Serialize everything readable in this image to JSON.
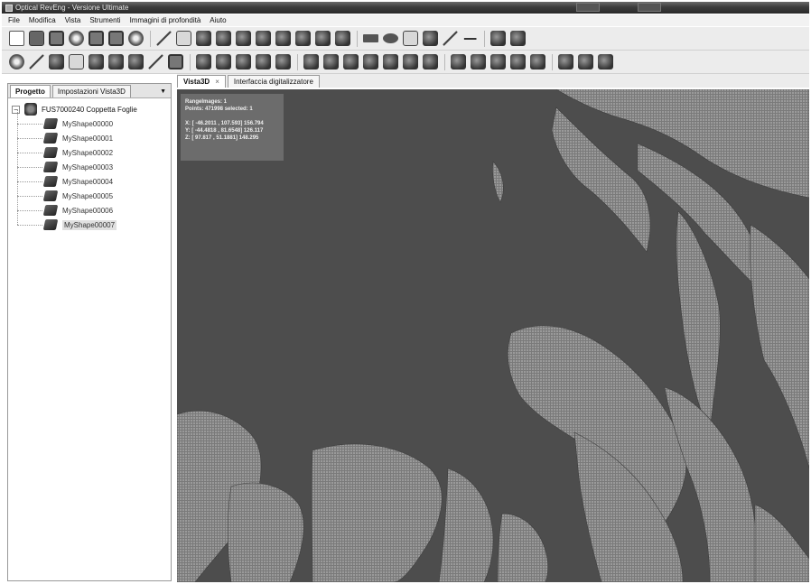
{
  "window": {
    "title": "Optical RevEng - Versione Ultimate"
  },
  "menu": [
    "File",
    "Modifica",
    "Vista",
    "Strumenti",
    "Immagini di profondità",
    "Aiuto"
  ],
  "toolbar1": {
    "icons": [
      "new-file-icon",
      "save-icon",
      "open-icon",
      "globe-icon",
      "monitor-icon",
      "screen-icon",
      "target-icon",
      "zoom-icon",
      "fit-view-icon",
      "scanner-icon",
      "scanner-alt-icon",
      "mesh-icon",
      "mesh-alt-icon",
      "camera-icon",
      "cube-icon",
      "transform-icon",
      "lock-icon",
      "rectangle-select-icon",
      "ellipse-select-icon",
      "lasso-select-icon",
      "edit-points-icon",
      "line-icon",
      "arrow-icon",
      "align-icon",
      "align-alt-icon"
    ]
  },
  "toolbar2": {
    "icons": [
      "grid-icon",
      "pointer-icon",
      "render-icon",
      "shaded-icon",
      "points-icon",
      "surface-icon",
      "wireframe-icon",
      "bounding-box-icon",
      "filter-icon",
      "decimate-icon",
      "smooth-icon",
      "merge-icon",
      "split-icon",
      "cut-icon",
      "tool-a-icon",
      "tool-b-icon",
      "tool-c-icon",
      "tool-d-icon",
      "tool-e-icon",
      "tool-f-icon",
      "tool-g-icon",
      "tool-h-icon",
      "tool-i-icon",
      "tool-j-icon",
      "tool-k-icon",
      "tool-l-icon",
      "tool-m-icon",
      "tool-n-icon",
      "tool-o-icon",
      "tool-p-icon",
      "tool-q-icon",
      "tool-r-icon"
    ]
  },
  "left_panel": {
    "tabs": [
      "Progetto",
      "Impostazioni Vista3D"
    ],
    "active_tab": "Progetto",
    "tree": {
      "root": "FUS7000240 Coppetta Foglie",
      "children": [
        "MyShape00000",
        "MyShape00001",
        "MyShape00002",
        "MyShape00003",
        "MyShape00004",
        "MyShape00005",
        "MyShape00006",
        "MyShape00007"
      ],
      "selected": "MyShape00007"
    }
  },
  "view": {
    "tabs": [
      "Vista3D",
      "Interfaccia digitalizzatore"
    ],
    "active_tab": "Vista3D",
    "close_glyph": "×",
    "info": {
      "line1": "RangeImages: 1",
      "line2": "Points: 471998  selected: 1",
      "line3": "X: [ -46.2011 , 107.593] 156.794",
      "line4": "Y: [ -44.4818 , 81.6548] 126.117",
      "line5": "Z: [ 97.817 , 51.1881] 148.295"
    },
    "background_color": "#4d4d4d",
    "mesh_color": "#8c8c8c"
  }
}
